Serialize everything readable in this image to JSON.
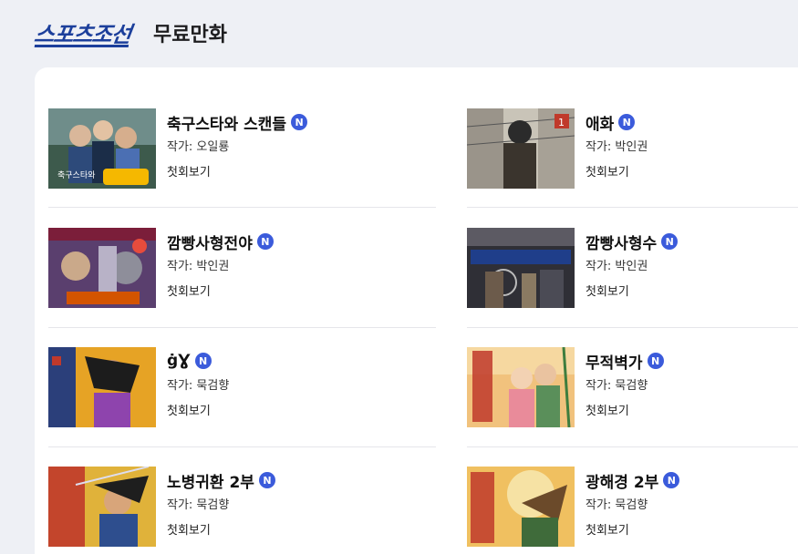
{
  "header": {
    "logo_text": "스포츠조선",
    "page_title": "무료만화"
  },
  "theme": {
    "brand_color": "#1c3f9b",
    "badge_color": "#3b5bdb",
    "background": "#eef0f5"
  },
  "comics": [
    {
      "title": "축구스타와 스캔들",
      "badge": "N",
      "author": "작가: 오일룡",
      "action": "첫회보기",
      "cover_text": "축구스타와"
    },
    {
      "title": "애화",
      "badge": "N",
      "author": "작가: 박인권",
      "action": "첫회보기",
      "cover_text": ""
    },
    {
      "title": "깜빵사형전야",
      "badge": "N",
      "author": "작가: 박인권",
      "action": "첫회보기",
      "cover_text": ""
    },
    {
      "title": "깜빵사형수",
      "badge": "N",
      "author": "작가: 박인권",
      "action": "첫회보기",
      "cover_text": ""
    },
    {
      "title": "ġƔ",
      "badge": "N",
      "author": "작가: 묵검향",
      "action": "첫회보기",
      "cover_text": ""
    },
    {
      "title": "무적벽가",
      "badge": "N",
      "author": "작가: 묵검향",
      "action": "첫회보기",
      "cover_text": ""
    },
    {
      "title": "노병귀환 2부",
      "badge": "N",
      "author": "작가: 묵검향",
      "action": "첫회보기",
      "cover_text": ""
    },
    {
      "title": "광해경 2부",
      "badge": "N",
      "author": "작가: 묵검향",
      "action": "첫회보기",
      "cover_text": ""
    }
  ]
}
